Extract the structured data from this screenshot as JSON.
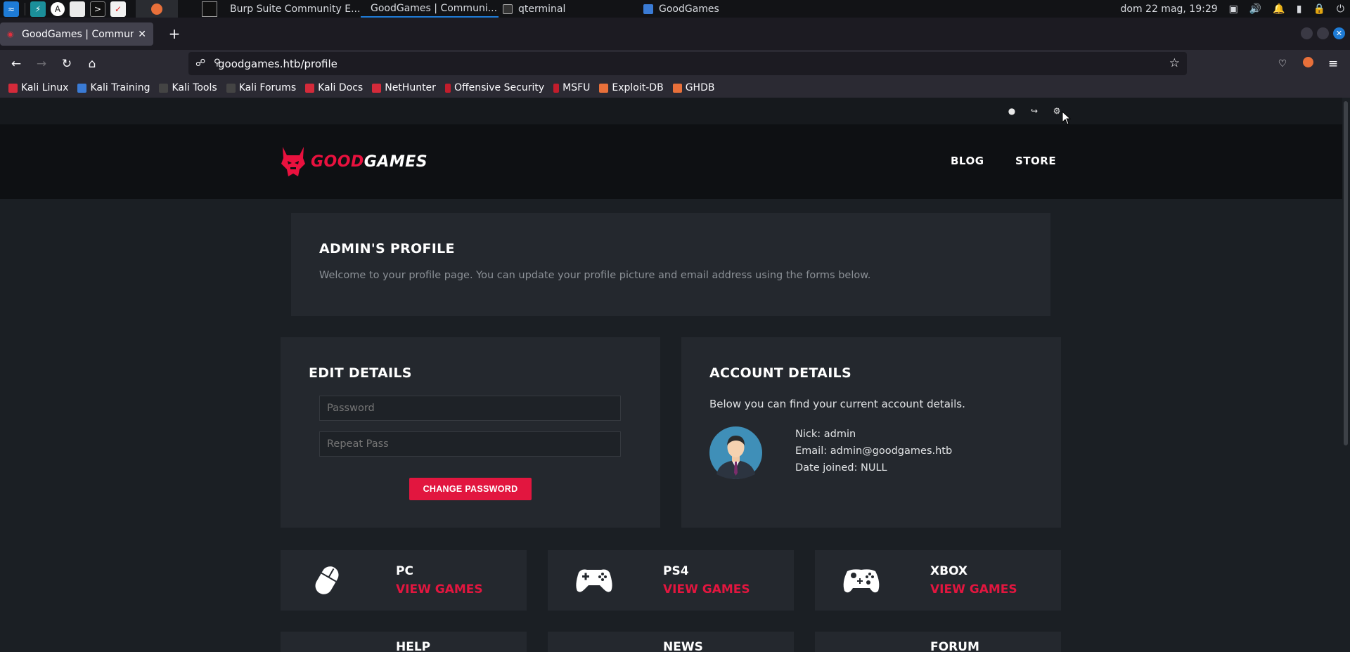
{
  "os": {
    "taskbar_windows": [
      "Burp Suite Community E...",
      "GoodGames | Communi...",
      "qterminal",
      "GoodGames"
    ],
    "clock": "dom 22 mag, 19:29"
  },
  "browser": {
    "tab_title": "GoodGames | Community",
    "url": "goodgames.htb/profile",
    "bookmarks": [
      "Kali Linux",
      "Kali Training",
      "Kali Tools",
      "Kali Forums",
      "Kali Docs",
      "NetHunter",
      "Offensive Security",
      "MSFU",
      "Exploit-DB",
      "GHDB"
    ]
  },
  "site": {
    "logo_part1": "GOOD",
    "logo_part2": "GAMES",
    "nav": [
      "BLOG",
      "STORE"
    ]
  },
  "profile": {
    "title": "ADMIN'S PROFILE",
    "description": "Welcome to your profile page. You can update your profile picture and email address using the forms below."
  },
  "edit": {
    "title": "EDIT DETAILS",
    "password_placeholder": "Password",
    "repeat_placeholder": "Repeat Pass",
    "button": "CHANGE PASSWORD"
  },
  "account": {
    "title": "ACCOUNT DETAILS",
    "intro": "Below you can find your current account details.",
    "nick": "Nick: admin",
    "email": "Email: admin@goodgames.htb",
    "joined": "Date joined: NULL"
  },
  "categories": [
    {
      "name": "PC",
      "link": "VIEW GAMES"
    },
    {
      "name": "PS4",
      "link": "VIEW GAMES"
    },
    {
      "name": "XBOX",
      "link": "VIEW GAMES"
    },
    {
      "name": "HELP"
    },
    {
      "name": "NEWS"
    },
    {
      "name": "FORUM"
    }
  ],
  "colors": {
    "accent": "#e2163f",
    "panel": "#24282e",
    "page": "#1b1f24"
  }
}
